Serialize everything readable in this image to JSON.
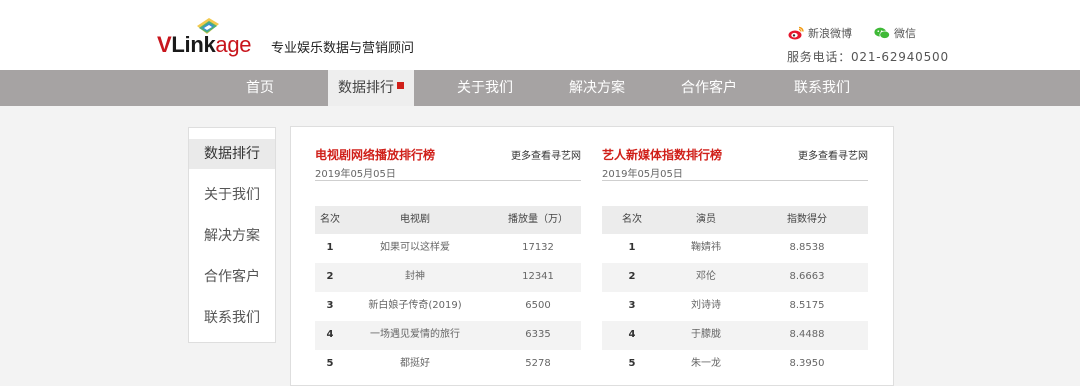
{
  "brand": {
    "logo_v": "V",
    "logo_link": "Link",
    "logo_age": "age",
    "tagline": "专业娱乐数据与营销顾问",
    "accent": "#c8161d"
  },
  "header": {
    "weibo_label": "新浪微博",
    "wechat_label": "微信",
    "phone": "服务电话：021-62940500"
  },
  "nav": {
    "items": [
      {
        "label": "首页"
      },
      {
        "label": "数据排行",
        "active": true
      },
      {
        "label": "关于我们"
      },
      {
        "label": "解决方案"
      },
      {
        "label": "合作客户"
      },
      {
        "label": "联系我们"
      }
    ]
  },
  "sidebar": {
    "items": [
      {
        "label": "数据排行",
        "active": true
      },
      {
        "label": "关于我们"
      },
      {
        "label": "解决方案"
      },
      {
        "label": "合作客户"
      },
      {
        "label": "联系我们"
      }
    ]
  },
  "tv_ranking": {
    "title": "电视剧网络播放排行榜",
    "more": "更多查看寻艺网",
    "date": "2019年05月05日",
    "columns": [
      "名次",
      "电视剧",
      "播放量（万）"
    ],
    "rows": [
      [
        "1",
        "如果可以这样爱",
        "17132"
      ],
      [
        "2",
        "封神",
        "12341"
      ],
      [
        "3",
        "新白娘子传奇(2019)",
        "6500"
      ],
      [
        "4",
        "一场遇见爱情的旅行",
        "6335"
      ],
      [
        "5",
        "都挺好",
        "5278"
      ]
    ]
  },
  "artist_ranking": {
    "title": "艺人新媒体指数排行榜",
    "more": "更多查看寻艺网",
    "date": "2019年05月05日",
    "columns": [
      "名次",
      "演员",
      "指数得分"
    ],
    "rows": [
      [
        "1",
        "鞠婧祎",
        "8.8538"
      ],
      [
        "2",
        "邓伦",
        "8.6663"
      ],
      [
        "3",
        "刘诗诗",
        "8.5175"
      ],
      [
        "4",
        "于朦胧",
        "8.4488"
      ],
      [
        "5",
        "朱一龙",
        "8.3950"
      ]
    ]
  }
}
